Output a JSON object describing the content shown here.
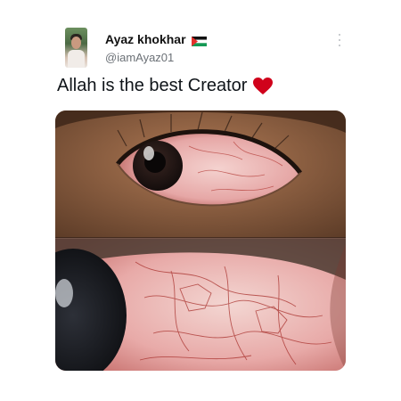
{
  "author": {
    "display_name": "Ayaz khokhar",
    "handle": "@iamAyaz01",
    "flag_icon": "palestine-flag-icon"
  },
  "tweet": {
    "text": "Allah is the best Creator",
    "emoji_icon": "red-heart-icon"
  },
  "menu_icon": "more-options-icon",
  "colors": {
    "text_primary": "#0f1419",
    "text_secondary": "#6b7076",
    "heart": "#d0021b"
  }
}
